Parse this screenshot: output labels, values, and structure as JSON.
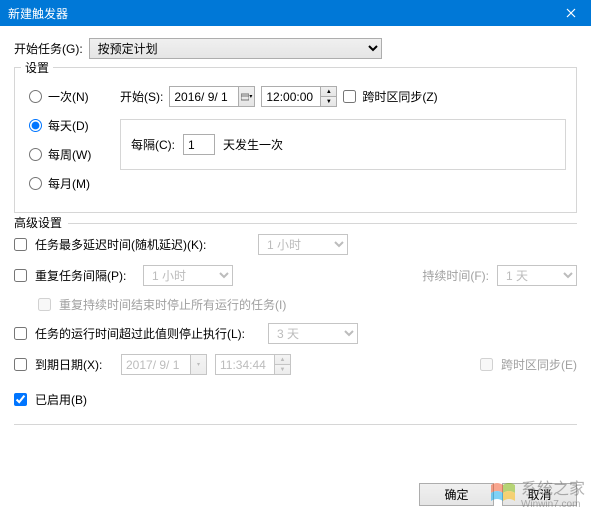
{
  "titlebar": {
    "title": "新建触发器"
  },
  "start_task": {
    "label": "开始任务(G):",
    "selected": "按预定计划"
  },
  "settings": {
    "legend": "设置",
    "radios": {
      "once": "一次(N)",
      "daily": "每天(D)",
      "weekly": "每周(W)",
      "monthly": "每月(M)"
    },
    "start_label": "开始(S):",
    "start_date": "2016/ 9/ 1",
    "start_time": "12:00:00",
    "sync_tz_label": "跨时区同步(Z)",
    "interval_label": "每隔(C):",
    "interval_value": "1",
    "interval_suffix": "天发生一次"
  },
  "advanced": {
    "legend": "高级设置",
    "delay_label": "任务最多延迟时间(随机延迟)(K):",
    "delay_value": "1 小时",
    "repeat_label": "重复任务间隔(P):",
    "repeat_value": "1 小时",
    "duration_label": "持续时间(F):",
    "duration_value": "1 天",
    "stop_repeat_label": "重复持续时间结束时停止所有运行的任务(I)",
    "stop_after_label": "任务的运行时间超过此值则停止执行(L):",
    "stop_after_value": "3 天",
    "expire_label": "到期日期(X):",
    "expire_date": "2017/ 9/ 1",
    "expire_time": "11:34:44",
    "expire_tz_label": "跨时区同步(E)",
    "enabled_label": "已启用(B)"
  },
  "footer": {
    "ok": "确定",
    "cancel": "取消"
  },
  "watermark": {
    "line1": "系统之家",
    "line2": "Winwin7.com"
  }
}
